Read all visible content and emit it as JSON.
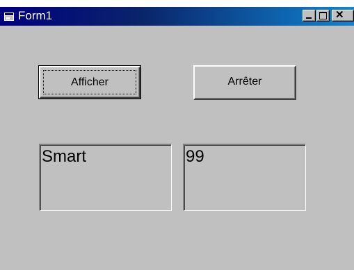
{
  "window": {
    "title": "Form1",
    "close_glyph": "✕",
    "icons": {
      "app": "form-app-icon",
      "minimize": "minimize-icon",
      "maximize": "maximize-icon",
      "close": "close-icon"
    }
  },
  "buttons": {
    "afficher_label": "Afficher",
    "arreter_label": "Arrêter"
  },
  "textboxes": {
    "first_value": "Smart",
    "second_value": "99"
  },
  "colors": {
    "face": "#c0c0c0",
    "title_start": "#000080",
    "title_end": "#1084d0"
  }
}
